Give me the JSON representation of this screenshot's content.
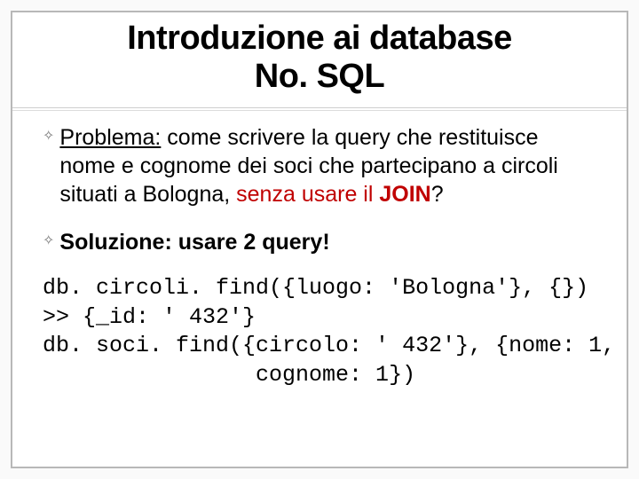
{
  "title_line1": "Introduzione ai database",
  "title_line2": "No. SQL",
  "bullets": [
    {
      "parts": [
        {
          "text": "Problema:",
          "style": "underline"
        },
        {
          "text": " come scrivere la query che restituisce nome e cognome dei soci che partecipano a circoli situati a Bologna, "
        },
        {
          "text": "senza usare il ",
          "style": "red"
        },
        {
          "text": "JOIN",
          "style": "red bold"
        },
        {
          "text": "?"
        }
      ]
    },
    {
      "parts": [
        {
          "text": "Soluzione: usare 2 query!",
          "style": "bold"
        }
      ]
    }
  ],
  "code_lines": [
    "db. circoli. find({luogo: 'Bologna'}, {})",
    ">> {_id: ' 432'}",
    "db. soci. find({circolo: ' 432'}, {nome: 1,",
    "                cognome: 1})"
  ]
}
